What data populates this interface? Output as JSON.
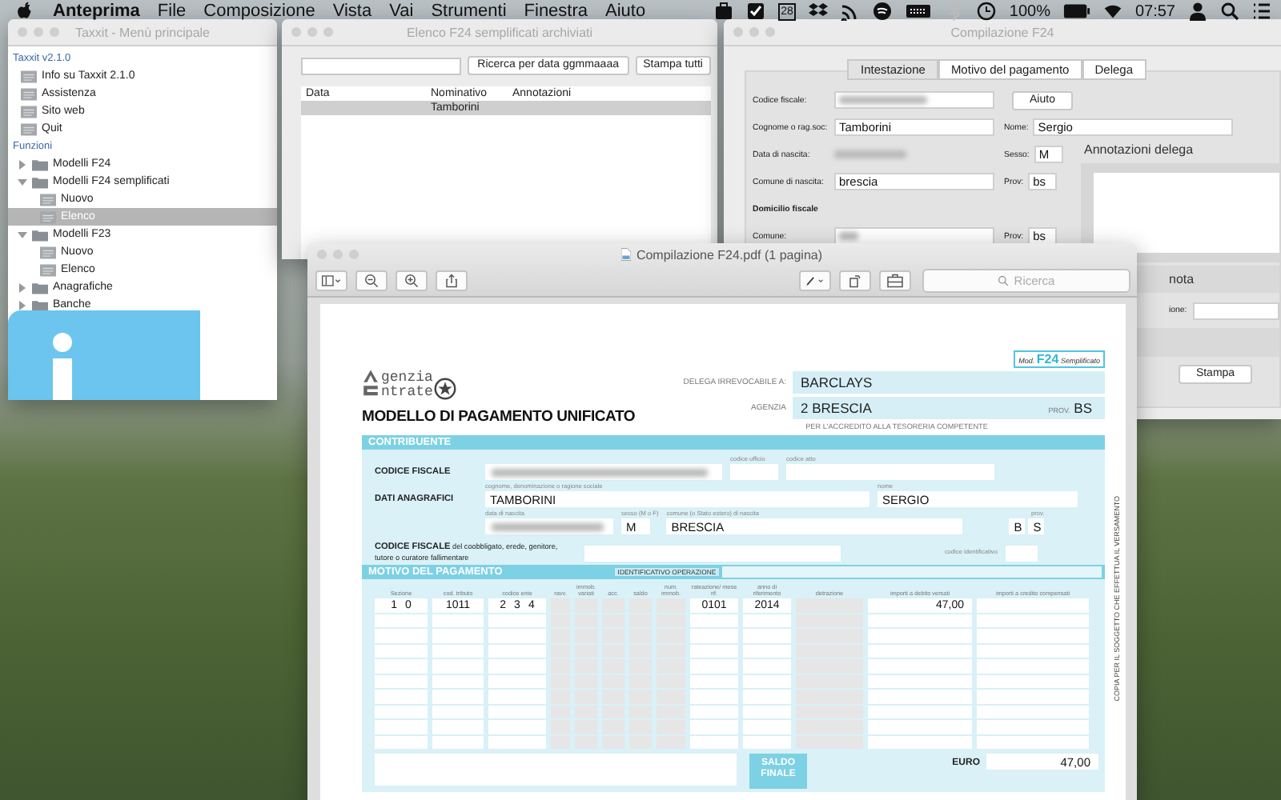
{
  "menubar": {
    "app_name": "Anteprima",
    "menus": [
      "File",
      "Composizione",
      "Vista",
      "Vai",
      "Strumenti",
      "Finestra",
      "Aiuto"
    ],
    "calendar_day": "28",
    "battery": "100%",
    "clock": "07:57"
  },
  "main_menu_window": {
    "title": "Taxxit - Menù principale",
    "sections": [
      {
        "heading": "Taxxit v2.1.0",
        "items": [
          {
            "label": "Info su Taxxit 2.1.0",
            "kind": "doc",
            "selected": false
          },
          {
            "label": "Assistenza",
            "kind": "doc",
            "selected": false
          },
          {
            "label": "Sito web",
            "kind": "doc",
            "selected": false
          },
          {
            "label": "Quit",
            "kind": "doc",
            "selected": false
          }
        ]
      },
      {
        "heading": "Funzioni",
        "items": [
          {
            "label": "Modelli F24",
            "kind": "folder",
            "expanded": false,
            "selected": false
          },
          {
            "label": "Modelli F24 semplificati",
            "kind": "folder",
            "expanded": true,
            "selected": false,
            "children": [
              {
                "label": "Nuovo",
                "kind": "doc",
                "selected": false
              },
              {
                "label": "Elenco",
                "kind": "doc",
                "selected": true
              }
            ]
          },
          {
            "label": "Modelli F23",
            "kind": "folder",
            "expanded": true,
            "selected": false,
            "children": [
              {
                "label": "Nuovo",
                "kind": "doc",
                "selected": false
              },
              {
                "label": "Elenco",
                "kind": "doc",
                "selected": false
              }
            ]
          },
          {
            "label": "Anagrafiche",
            "kind": "folder",
            "expanded": false,
            "selected": false
          },
          {
            "label": "Banche",
            "kind": "folder",
            "expanded": false,
            "selected": false
          }
        ]
      }
    ]
  },
  "archive_window": {
    "title": "Elenco F24 semplificati archiviati",
    "buttons": [
      "Ricerca per data ggmmaaaa",
      "Stampa tutti"
    ],
    "columns": [
      "Data",
      "Nominativo",
      "Annotazioni"
    ],
    "rows": [
      {
        "nominativo": "Tamborini",
        "selected": true
      }
    ]
  },
  "compile_window": {
    "title": "Compilazione F24",
    "tabs": [
      {
        "label": "Intestazione",
        "selected": true
      },
      {
        "label": "Motivo del pagamento",
        "selected": false
      },
      {
        "label": "Delega",
        "selected": false
      }
    ],
    "tax_code": {
      "label": "Codice fiscale:"
    },
    "help_button": "Aiuto",
    "surname": {
      "label": "Cognome o rag.soc:",
      "value": "Tamborini"
    },
    "name": {
      "label": "Nome:",
      "value": "Sergio"
    },
    "birth_date": {
      "label": "Data di nascita:"
    },
    "sex": {
      "label": "Sesso:",
      "value": "M"
    },
    "birth_place": {
      "label": "Comune di nascita:",
      "value": "brescia"
    },
    "birth_prov": {
      "label": "Prov:",
      "value": "bs"
    },
    "domicile_heading": "Domicilio fiscale",
    "domicile_town": {
      "label": "Comune:"
    },
    "domicile_prov": {
      "label": "Prov:",
      "value": "bs"
    },
    "notes_heading": "Annotazioni delega",
    "note_heading": "nota",
    "partial_label": "ione:",
    "print_button": "Stampa"
  },
  "pdf_window": {
    "title": "Compilazione F24.pdf (1 pagina)",
    "search_placeholder": "Ricerca",
    "form": {
      "logo_lines": [
        "genzia",
        "ntrate"
      ],
      "title": "MODELLO DI PAGAMENTO UNIFICATO",
      "badge": {
        "prefix": "Mod.",
        "code": "F24",
        "suffix": "Semplificato"
      },
      "delegation": {
        "label": "DELEGA IRREVOCABILE A:",
        "value": "BARCLAYS"
      },
      "agency": {
        "label": "AGENZIA",
        "value": "2 BRESCIA",
        "prov_label": "PROV.",
        "prov": "BS"
      },
      "treasury_note": "PER L'ACCREDITO ALLA TESORERIA COMPETENTE",
      "contributor": {
        "heading": "CONTRIBUENTE",
        "tax_code_label": "CODICE FISCALE",
        "office_code_caption": "codice ufficio",
        "act_code_caption": "codice atto",
        "personal_label": "DATI ANAGRAFICI",
        "surname_caption": "cognome, denominazione o ragione sociale",
        "surname": "TAMBORINI",
        "name_caption": "nome",
        "name": "SERGIO",
        "birth_caption": "data di nascita",
        "sex_caption": "sesso (M o F)",
        "sex": "M",
        "birthplace_caption": "comune (o Stato estero) di nascita",
        "birthplace": "BRESCIA",
        "prov_caption": "prov.",
        "prov": [
          "B",
          "S"
        ],
        "coobligated_label": "CODICE FISCALE",
        "coobligated_note": "del coobbligato, erede, genitore, tutore o curatore fallimentare",
        "id_code_caption": "codice identificativo"
      },
      "payment": {
        "heading": "MOTIVO DEL PAGAMENTO",
        "operation_id_label": "IDENTIFICATIVO OPERAZIONE",
        "columns": [
          "Sezione",
          "cod. tributo",
          "codice ente",
          "ravv.",
          "immob. variati",
          "acc.",
          "saldo",
          "num. immob.",
          "rateazione/ mese rif.",
          "anno di riferimento",
          "detrazione",
          "importi a debito versati",
          "importi a credito compensati"
        ],
        "rows": [
          {
            "sezione": [
              "1",
              "0"
            ],
            "codice_tributo": "1011",
            "codice_ente": [
              "2",
              "3",
              "4"
            ],
            "rateazione": "0101",
            "anno": "2014",
            "importo_debito": "47,00"
          }
        ],
        "total_label": "SALDO FINALE",
        "euro_label": "EURO",
        "total": "47,00"
      },
      "side_note": "COPIA PER IL SOGGETTO CHE EFFETTUA IL VERSAMENTO"
    }
  }
}
